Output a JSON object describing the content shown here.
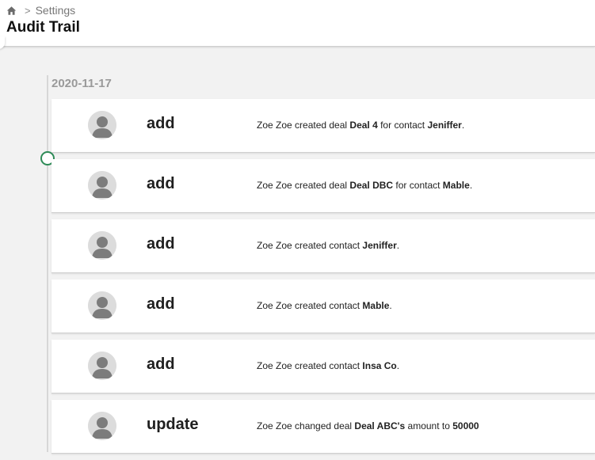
{
  "breadcrumb": {
    "separator": ">",
    "items": [
      {
        "label": "Settings"
      }
    ]
  },
  "page": {
    "title": "Audit Trail"
  },
  "timeline": {
    "date": "2020-11-17",
    "entries": [
      {
        "action": "add",
        "desc": {
          "p1": "Zoe Zoe created deal ",
          "b1": "Deal 4",
          "p2": " for contact ",
          "b2": "Jeniffer",
          "p3": "."
        }
      },
      {
        "action": "add",
        "desc": {
          "p1": "Zoe Zoe created deal ",
          "b1": "Deal DBC",
          "p2": " for contact ",
          "b2": "Mable",
          "p3": "."
        }
      },
      {
        "action": "add",
        "desc": {
          "p1": "Zoe Zoe created contact ",
          "b1": "Jeniffer",
          "p2": ".",
          "b2": "",
          "p3": ""
        }
      },
      {
        "action": "add",
        "desc": {
          "p1": "Zoe Zoe created contact ",
          "b1": "Mable",
          "p2": ".",
          "b2": "",
          "p3": ""
        }
      },
      {
        "action": "add",
        "desc": {
          "p1": "Zoe Zoe created contact ",
          "b1": "Insa Co",
          "p2": ".",
          "b2": "",
          "p3": ""
        }
      },
      {
        "action": "update",
        "desc": {
          "p1": "Zoe Zoe changed deal ",
          "b1": "Deal ABC's",
          "p2": " amount to ",
          "b2": "50000",
          "p3": ""
        }
      }
    ]
  },
  "icons": {
    "home": "home-icon",
    "avatar": "user-avatar-icon"
  },
  "colors": {
    "accent_marker": "#2e8b57",
    "header_bg": "#ffffff",
    "page_bg": "#f2f2f2"
  }
}
